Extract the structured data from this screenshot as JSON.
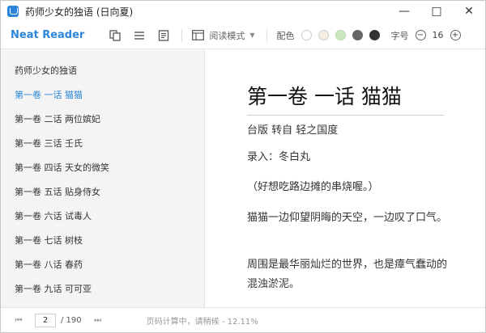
{
  "window": {
    "title": "药师少女的独语 (日向夏)",
    "controls": {
      "minimize": "—",
      "maximize": "□",
      "close": "✕"
    }
  },
  "toolbar": {
    "brand": "Neat Reader",
    "icons": [
      "copy-icon",
      "list-icon",
      "document-icon"
    ],
    "mode_label": "阅读模式",
    "color_label": "配色",
    "swatches": [
      "#ffffff",
      "#f5eedf",
      "#cde8c0",
      "#666666",
      "#333333"
    ],
    "font_label": "字号",
    "font_size": "16",
    "minus": "−",
    "plus": "+"
  },
  "sidebar": {
    "items": [
      {
        "label": "药师少女的独语",
        "active": false
      },
      {
        "label": "第一卷 一话 猫猫",
        "active": true
      },
      {
        "label": "第一卷 二话 两位嫔妃",
        "active": false
      },
      {
        "label": "第一卷 三话 壬氏",
        "active": false
      },
      {
        "label": "第一卷 四话 天女的微笑",
        "active": false
      },
      {
        "label": "第一卷 五话 贴身侍女",
        "active": false
      },
      {
        "label": "第一卷 六话 试毒人",
        "active": false
      },
      {
        "label": "第一卷 七话 树枝",
        "active": false
      },
      {
        "label": "第一卷 八话 春药",
        "active": false
      },
      {
        "label": "第一卷 九话 可可亚",
        "active": false
      }
    ]
  },
  "content": {
    "chapter_title": "第一卷 一话 猫猫",
    "paragraphs": [
      "台版 转自 轻之国度",
      "录入：冬白丸",
      "（好想吃路边摊的串烧喔。）",
      "猫猫一边仰望阴晦的天空，一边叹了口气。",
      "周围是最华丽灿烂的世界，也是瘴气蠢动的混浊淤泥。"
    ]
  },
  "statusbar": {
    "first": "⏮",
    "prev": "◀",
    "current_page": "2",
    "total_pages": "/ 190",
    "next": "▶",
    "last": "⏭",
    "status": "页码计算中，请稍候 - 12.11%"
  }
}
